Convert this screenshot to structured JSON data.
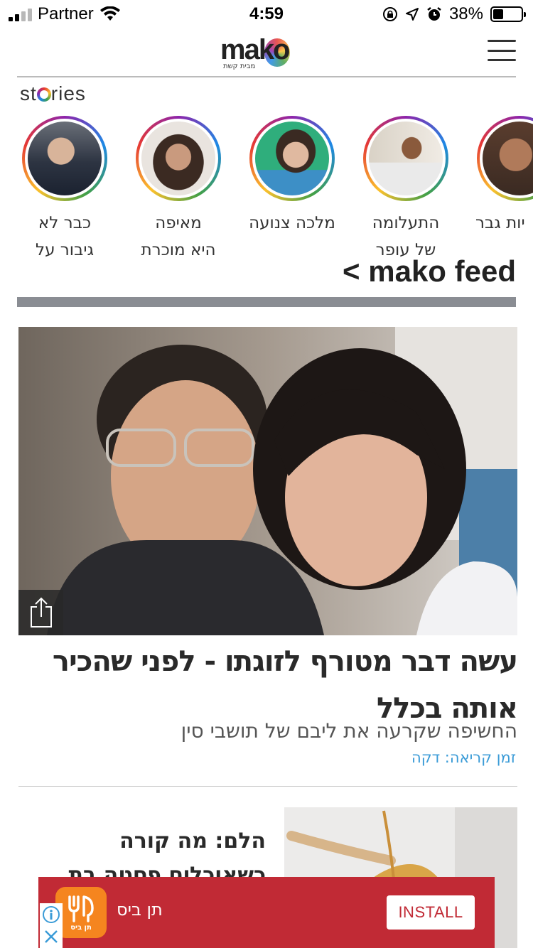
{
  "status_bar": {
    "carrier": "Partner",
    "time": "4:59",
    "battery_percent": "38%",
    "battery_level": 0.38
  },
  "header": {
    "logo_text": "mako",
    "logo_subtitle": "מבית קשת",
    "menu_icon": "hamburger-icon"
  },
  "stories": {
    "title_prefix": "st",
    "title_suffix": "ries",
    "items": [
      {
        "label_line1": "כבר לא",
        "label_line2": "גיבור על"
      },
      {
        "label_line1": "מאיפה",
        "label_line2": "היא מוכרת"
      },
      {
        "label_line1": "מלכה צנועה",
        "label_line2": ""
      },
      {
        "label_line1": "התעלומה",
        "label_line2": "של עופר"
      },
      {
        "label_line1": "יות גבר",
        "label_line2": ""
      }
    ]
  },
  "feed": {
    "heading": "mako feed",
    "arrow": "<"
  },
  "main_article": {
    "headline": "עשה דבר מטורף לזוגתו - לפני שהכיר אותה בכלל",
    "subhead": "החשיפה שקרעה את ליבם של תושבי סין",
    "read_time": "זמן קריאה: דקה",
    "share_icon": "share-icon"
  },
  "second_article": {
    "title": "הלם: מה קורה כשאוכלים פסטה בת חמישה ימים?"
  },
  "ad": {
    "app_name": "תן ביס",
    "icon_caption": "תן ביס",
    "install_label": "INSTALL",
    "background": "#c12a35",
    "icon_color": "#f5851f"
  },
  "colors": {
    "read_time": "#3a9bd7",
    "feed_bar": "#8a8d93"
  }
}
